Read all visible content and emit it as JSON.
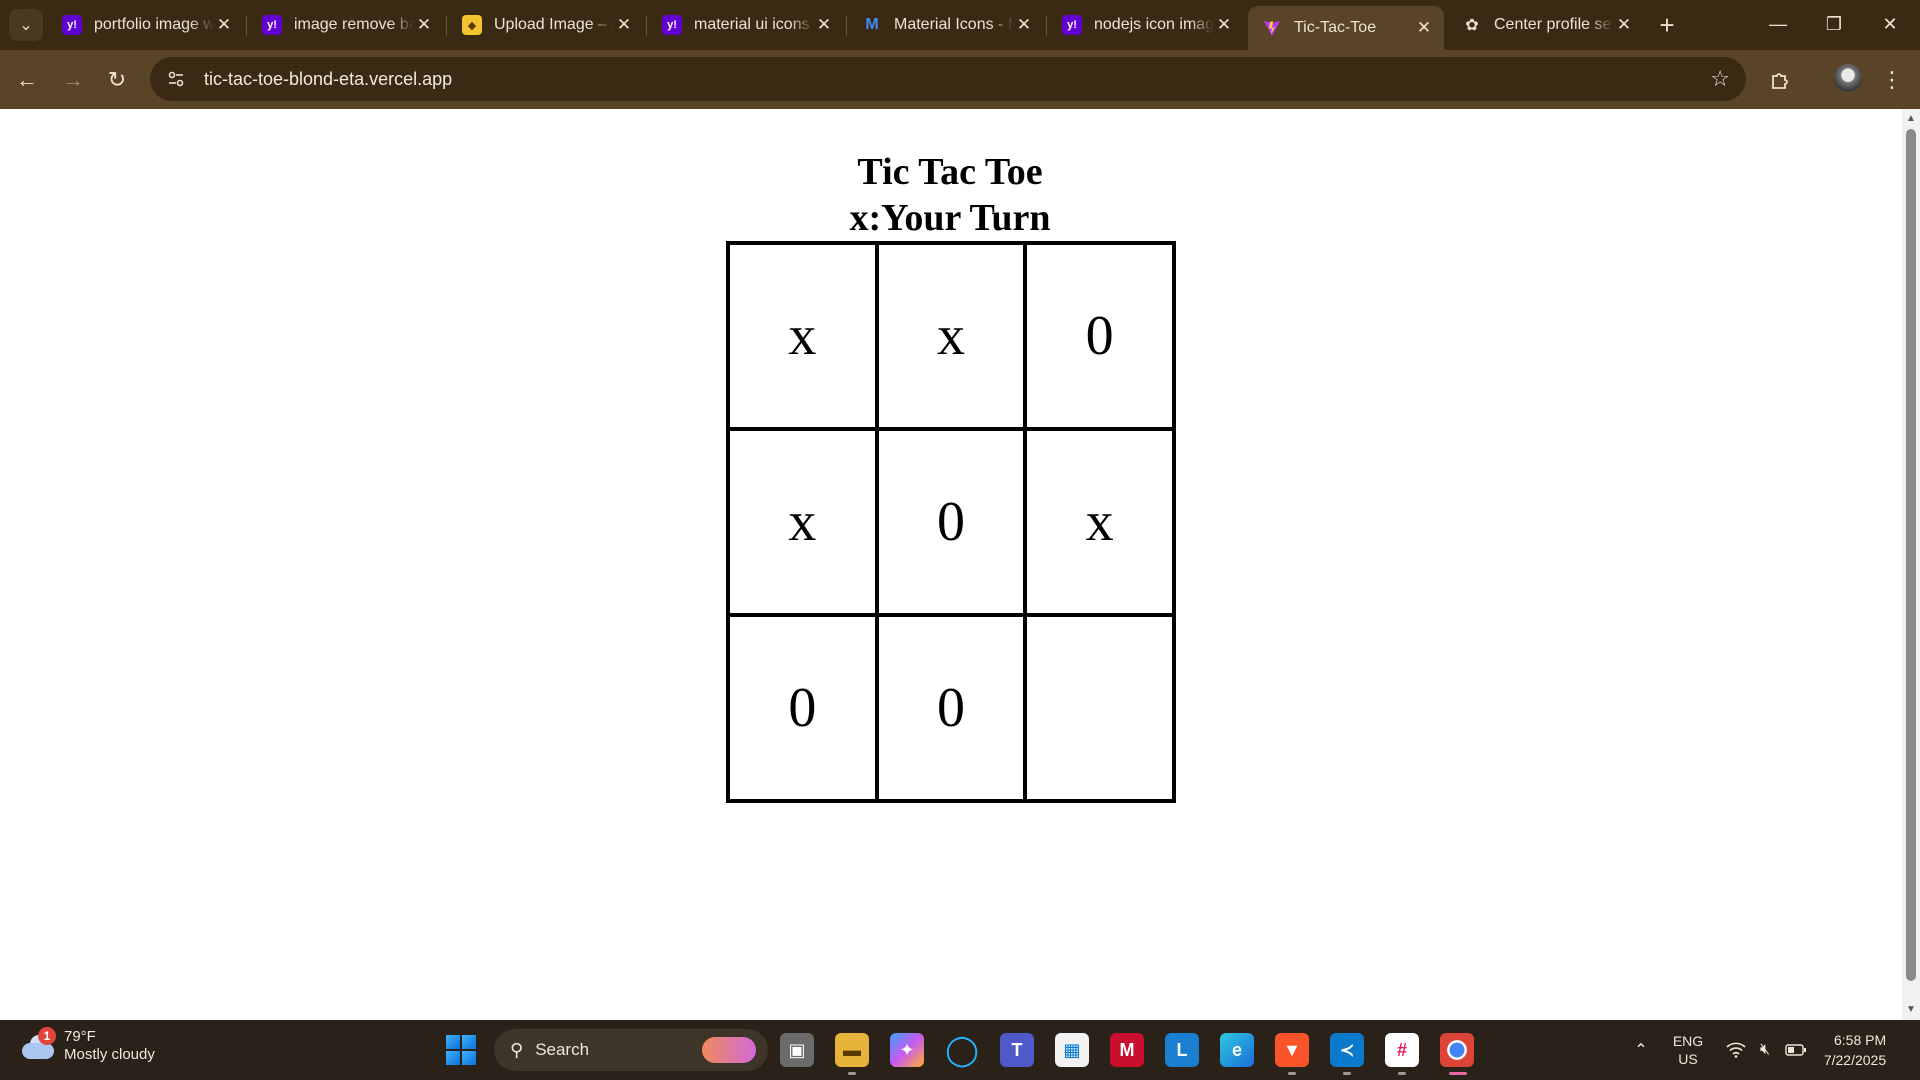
{
  "browser": {
    "tabs": [
      {
        "title": "portfolio image w",
        "favicon": "yahoo",
        "favicon_text": "y!",
        "active": false
      },
      {
        "title": "image remove ba",
        "favicon": "yahoo",
        "favicon_text": "y!",
        "active": false
      },
      {
        "title": "Upload Image – d",
        "favicon": "upload",
        "favicon_text": "◆",
        "active": false
      },
      {
        "title": "material ui icons",
        "favicon": "yahoo",
        "favicon_text": "y!",
        "active": false
      },
      {
        "title": "Material Icons - M",
        "favicon": "mui",
        "favicon_text": "M",
        "active": false
      },
      {
        "title": "nodejs icon imag",
        "favicon": "yahoo",
        "favicon_text": "y!",
        "active": false
      },
      {
        "title": "Tic-Tac-Toe",
        "favicon": "vite",
        "favicon_text": "",
        "active": true
      },
      {
        "title": "Center profile se",
        "favicon": "gpt",
        "favicon_text": "✿",
        "active": false
      }
    ],
    "url": "tic-tac-toe-blond-eta.vercel.app"
  },
  "game": {
    "title": "Tic Tac Toe",
    "status": "x:Your Turn",
    "board": [
      "x",
      "x",
      "0",
      "x",
      "0",
      "x",
      "0",
      "0",
      ""
    ]
  },
  "taskbar": {
    "weather_badge": "1",
    "temperature": "79°F",
    "condition": "Mostly cloudy",
    "search_placeholder": "Search",
    "lang_top": "ENG",
    "lang_bottom": "US",
    "time": "6:58 PM",
    "date": "7/22/2025"
  },
  "colors": {
    "tab_bar": "#3a2a14",
    "toolbar": "#5a4428",
    "taskbar": "#2a2118"
  }
}
